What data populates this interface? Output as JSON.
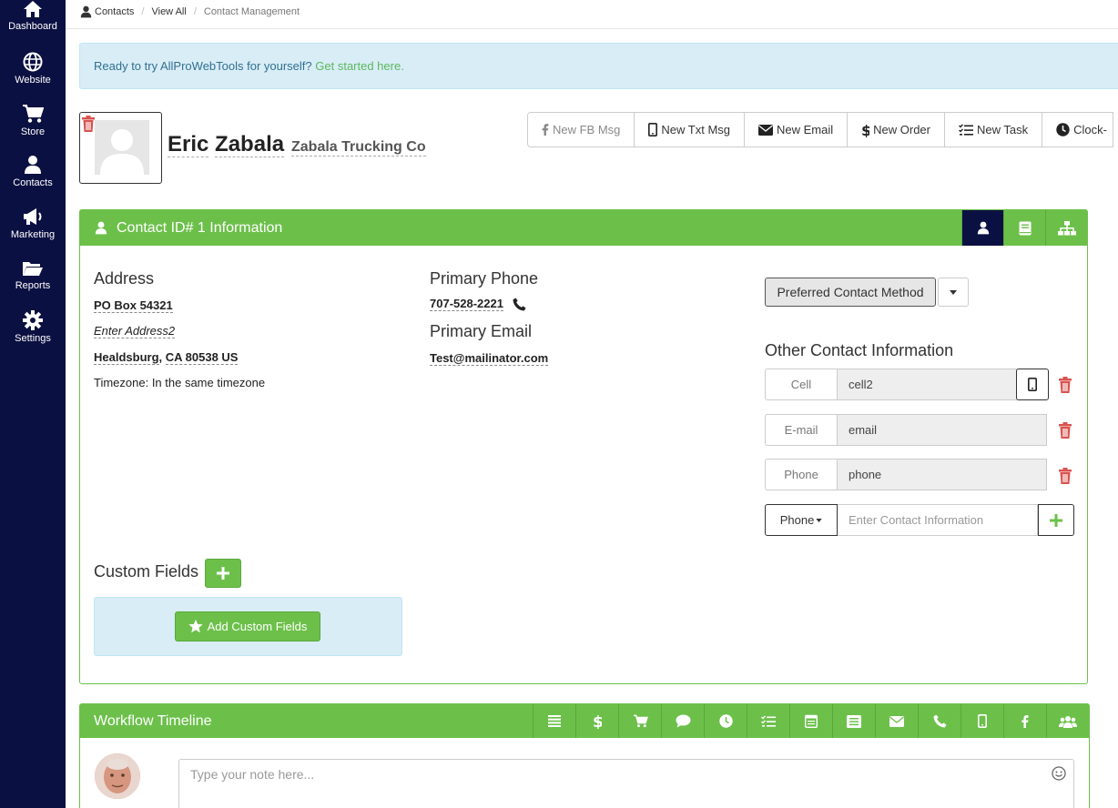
{
  "sidebar": {
    "items": [
      {
        "label": "Dashboard",
        "icon": "home-icon"
      },
      {
        "label": "Website",
        "icon": "globe-icon"
      },
      {
        "label": "Store",
        "icon": "cart-icon"
      },
      {
        "label": "Contacts",
        "icon": "user-icon"
      },
      {
        "label": "Marketing",
        "icon": "megaphone-icon"
      },
      {
        "label": "Reports",
        "icon": "folder-icon"
      },
      {
        "label": "Settings",
        "icon": "gear-icon"
      }
    ]
  },
  "breadcrumb": {
    "contacts": "Contacts",
    "view_all": "View All",
    "current": "Contact Management",
    "separator": "/"
  },
  "alert": {
    "text": "Ready to try AllProWebTools for yourself? ",
    "link": "Get started here."
  },
  "contact": {
    "first_name": "Eric",
    "last_name": "Zabala",
    "company": "Zabala Trucking Co"
  },
  "actions": {
    "fb_msg": "New FB Msg",
    "txt_msg": "New Txt Msg",
    "email": "New Email",
    "order": "New Order",
    "task": "New Task",
    "clock": "Clock-"
  },
  "info_panel": {
    "title": "Contact ID# 1 Information",
    "address_title": "Address",
    "address1": "PO Box 54321",
    "address2": "Enter Address2",
    "city": "Healdsburg",
    "state_zip": "CA 80538 US",
    "timezone": "Timezone: In the same timezone",
    "phone_title": "Primary Phone",
    "phone": "707-528-2221",
    "email_title": "Primary Email",
    "email": "Test@mailinator.com",
    "preferred_method": "Preferred Contact Method",
    "other_title": "Other Contact Information",
    "other_rows": [
      {
        "label": "Cell",
        "value": "cell2"
      },
      {
        "label": "E-mail",
        "value": "email"
      },
      {
        "label": "Phone",
        "value": "phone"
      }
    ],
    "new_type": "Phone",
    "new_placeholder": "Enter Contact Information",
    "custom_fields_title": "Custom Fields",
    "add_custom_fields": "Add Custom Fields"
  },
  "workflow": {
    "title": "Workflow Timeline",
    "note_placeholder": "Type your note here..."
  },
  "colors": {
    "sidebar_bg": "#0b1042",
    "accent_green": "#6cc04a",
    "danger_red": "#d9534f",
    "alert_bg": "#d9edf7"
  }
}
